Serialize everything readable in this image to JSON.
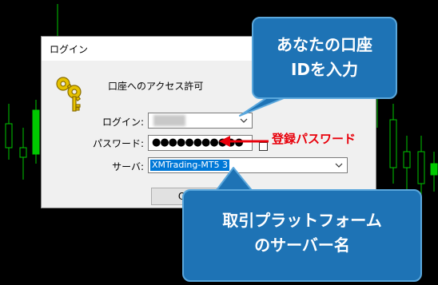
{
  "dialog": {
    "title": "ログイン",
    "prompt": "口座へのアクセス許可",
    "login_label": "ログイン:",
    "login_value": "",
    "password_label": "パスワード:",
    "password_value": "●●●●●●●●●●●",
    "server_label": "サーバ:",
    "server_value": "XMTrading-MT5 3",
    "ok_label": "OK"
  },
  "annotations": {
    "callout_account": "あなたの口座 IDを入力",
    "callout_account_line1": "あなたの口座",
    "callout_account_line2": "IDを入力",
    "callout_server_line1": "取引プラットフォーム",
    "callout_server_line2": "のサーバー名",
    "password_hint": "登録パスワード"
  },
  "colors": {
    "callout_bg": "#1e73b5",
    "callout_border": "#5aa7dc",
    "annotation_red": "#e8000b",
    "candle_up": "#00c800",
    "selection": "#0078d7"
  },
  "icons": [
    "keys-icon",
    "chevron-down-icon"
  ]
}
